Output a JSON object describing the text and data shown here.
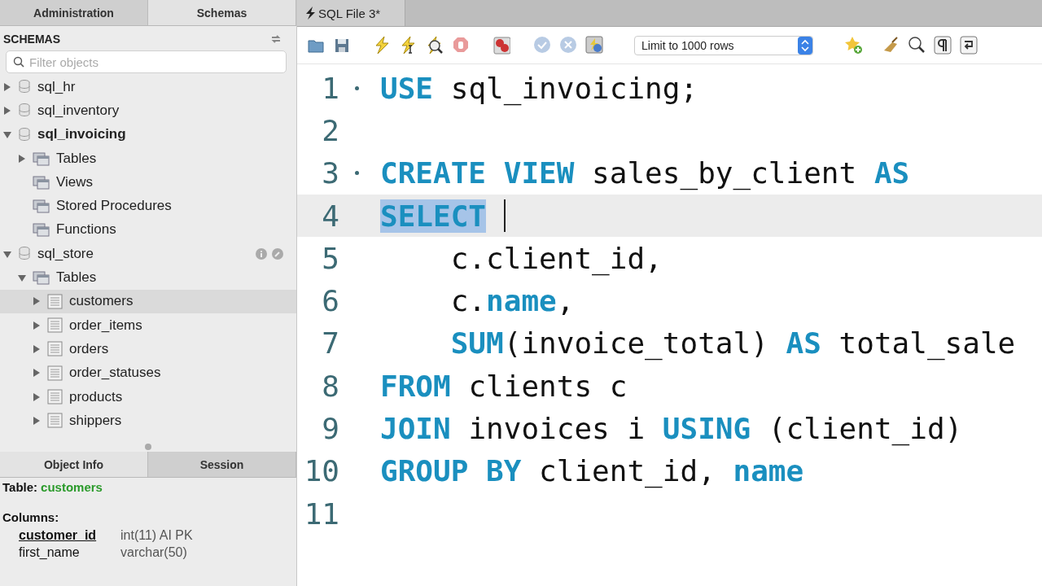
{
  "sidebar_tabs": [
    {
      "label": "Administration",
      "selected": false
    },
    {
      "label": "Schemas",
      "selected": true
    }
  ],
  "navigator": {
    "title": "SCHEMAS",
    "search": {
      "placeholder": "Filter objects"
    },
    "tree": [
      {
        "label": "sql_hr",
        "kind": "schema",
        "expanded": false,
        "default": false,
        "selected": false,
        "hovered": false
      },
      {
        "label": "sql_inventory",
        "kind": "schema",
        "expanded": false,
        "default": false,
        "selected": false,
        "hovered": false
      },
      {
        "label": "sql_invoicing",
        "kind": "schema",
        "expanded": true,
        "default": true,
        "selected": false,
        "hovered": false,
        "children": [
          {
            "label": "Tables",
            "kind": "folder",
            "expanded": false,
            "selected": false
          },
          {
            "label": "Views",
            "kind": "folder",
            "selected": false
          },
          {
            "label": "Stored Procedures",
            "kind": "folder",
            "selected": false
          },
          {
            "label": "Functions",
            "kind": "folder",
            "selected": false
          }
        ]
      },
      {
        "label": "sql_store",
        "kind": "schema",
        "expanded": true,
        "default": false,
        "selected": false,
        "hovered": true,
        "children": [
          {
            "label": "Tables",
            "kind": "folder",
            "expanded": true,
            "selected": false,
            "children": [
              {
                "label": "customers",
                "kind": "table",
                "expanded": false,
                "selected": true
              },
              {
                "label": "order_items",
                "kind": "table",
                "expanded": false,
                "selected": false
              },
              {
                "label": "orders",
                "kind": "table",
                "expanded": false,
                "selected": false
              },
              {
                "label": "order_statuses",
                "kind": "table",
                "expanded": false,
                "selected": false
              },
              {
                "label": "products",
                "kind": "table",
                "expanded": false,
                "selected": false
              },
              {
                "label": "shippers",
                "kind": "table",
                "expanded": false,
                "selected": false
              }
            ]
          }
        ]
      }
    ]
  },
  "info_tabs": [
    {
      "label": "Object Info",
      "selected": true
    },
    {
      "label": "Session",
      "selected": false
    }
  ],
  "object_info": {
    "label": "Table:",
    "name": "customers",
    "columns_title": "Columns:",
    "columns": [
      {
        "name": "customer_id",
        "type": "int(11) AI PK",
        "primary_key": true
      },
      {
        "name": "first_name",
        "type": "varchar(50)",
        "primary_key": false
      }
    ]
  },
  "editor_tabs": [
    {
      "label": "SQL File 3*",
      "selected": true
    }
  ],
  "toolbar": {
    "limit": "Limit to 1000 rows"
  },
  "code": [
    {
      "number": "1",
      "marker": true,
      "current": false,
      "tokens": [
        {
          "text": "USE",
          "kind": "keyword"
        },
        {
          "text": " sql_invoicing;",
          "kind": "plain"
        }
      ]
    },
    {
      "number": "2",
      "marker": false,
      "current": false
    },
    {
      "number": "3",
      "marker": true,
      "current": false,
      "tokens": [
        {
          "text": "CREATE VIEW",
          "kind": "keyword"
        },
        {
          "text": " sales_by_client ",
          "kind": "plain"
        },
        {
          "text": "AS",
          "kind": "keyword"
        }
      ]
    },
    {
      "number": "4",
      "marker": false,
      "current": true,
      "caret": true,
      "tokens": [
        {
          "text": "SELECT",
          "kind": "keyword",
          "selected": true
        }
      ]
    },
    {
      "number": "5",
      "marker": false,
      "current": false,
      "indent": true,
      "tokens": [
        {
          "text": "c.client_id,",
          "kind": "plain"
        }
      ]
    },
    {
      "number": "6",
      "marker": false,
      "current": false,
      "indent": true,
      "tokens": [
        {
          "text": "c.",
          "kind": "plain"
        },
        {
          "text": "name",
          "kind": "keyword"
        },
        {
          "text": ",",
          "kind": "plain"
        }
      ]
    },
    {
      "number": "7",
      "marker": false,
      "current": false,
      "indent": true,
      "tokens": [
        {
          "text": "SUM",
          "kind": "keyword"
        },
        {
          "text": "(invoice_total) ",
          "kind": "plain"
        },
        {
          "text": "AS",
          "kind": "keyword"
        },
        {
          "text": " total_sale",
          "kind": "plain"
        }
      ]
    },
    {
      "number": "8",
      "marker": false,
      "current": false,
      "tokens": [
        {
          "text": "FROM",
          "kind": "keyword"
        },
        {
          "text": " clients c",
          "kind": "plain"
        }
      ]
    },
    {
      "number": "9",
      "marker": false,
      "current": false,
      "tokens": [
        {
          "text": "JOIN",
          "kind": "keyword"
        },
        {
          "text": " invoices i ",
          "kind": "plain"
        },
        {
          "text": "USING",
          "kind": "keyword"
        },
        {
          "text": " (client_id)",
          "kind": "plain"
        }
      ]
    },
    {
      "number": "10",
      "marker": false,
      "current": false,
      "tokens": [
        {
          "text": "GROUP BY",
          "kind": "keyword"
        },
        {
          "text": " client_id, ",
          "kind": "plain"
        },
        {
          "text": "name",
          "kind": "keyword"
        }
      ]
    },
    {
      "number": "11",
      "marker": false,
      "current": false
    }
  ]
}
